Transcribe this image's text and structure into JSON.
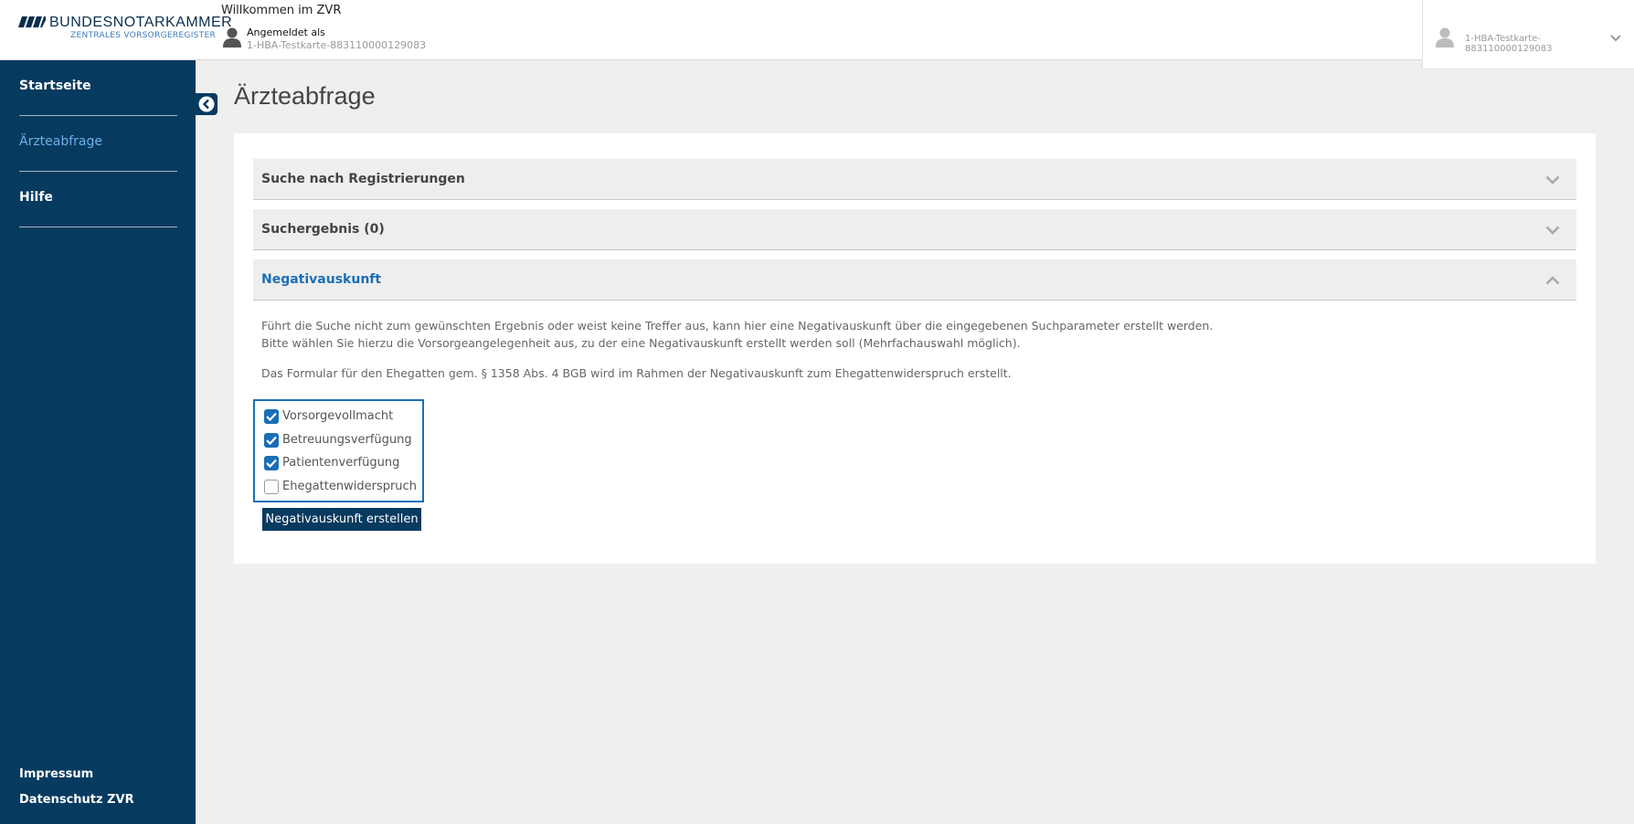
{
  "header": {
    "brand_name": "BUNDESNOTARKAMMER",
    "brand_sub": "ZENTRALES VORSORGEREGISTER",
    "welcome": "Willkommen im ZVR",
    "logged_in_label": "Angemeldet als",
    "logged_in_id": "1-HBA-Testkarte-883110000129083",
    "user_menu_line1": "1-HBA-Testkarte-",
    "user_menu_line2": "883110000129083"
  },
  "sidebar": {
    "items": [
      {
        "label": "Startseite",
        "active": false
      },
      {
        "label": "Ärzteabfrage",
        "active": true
      },
      {
        "label": "Hilfe",
        "active": false
      }
    ],
    "footer": {
      "impressum": "Impressum",
      "datenschutz": "Datenschutz ZVR"
    }
  },
  "main": {
    "title": "Ärzteabfrage",
    "accordion": [
      {
        "label": "Suche nach Registrierungen",
        "open": false
      },
      {
        "label": "Suchergebnis (0)",
        "open": false
      },
      {
        "label": "Negativauskunft",
        "open": true
      }
    ],
    "negativ": {
      "paragraph1_line1": "Führt die Suche nicht zum gewünschten Ergebnis oder weist keine Treffer aus, kann hier eine Negativauskunft über die eingegebenen Suchparameter erstellt werden.",
      "paragraph1_line2": "Bitte wählen Sie hierzu die Vorsorgeangelegenheit aus, zu der eine Negativauskunft erstellt werden soll (Mehrfachauswahl möglich).",
      "paragraph2": "Das Formular für den Ehegatten gem. § 1358 Abs. 4 BGB wird im Rahmen der Negativauskunft zum Ehegattenwiderspruch erstellt.",
      "options": [
        {
          "label": "Vorsorgevollmacht",
          "checked": true
        },
        {
          "label": "Betreuungsverfügung",
          "checked": true
        },
        {
          "label": "Patientenverfügung",
          "checked": true
        },
        {
          "label": "Ehegattenwiderspruch",
          "checked": false
        }
      ],
      "submit_label": "Negativauskunft erstellen"
    }
  },
  "colors": {
    "sidebar_bg": "#073a5f",
    "accent_blue": "#1a6fb6",
    "active_nav": "#6cb2ea"
  },
  "icons": {
    "user": "user-icon",
    "chevron_down": "chevron-down-icon",
    "chevron_up": "chevron-up-icon",
    "collapse": "chevron-left-circle-icon",
    "check": "checkmark-icon"
  }
}
